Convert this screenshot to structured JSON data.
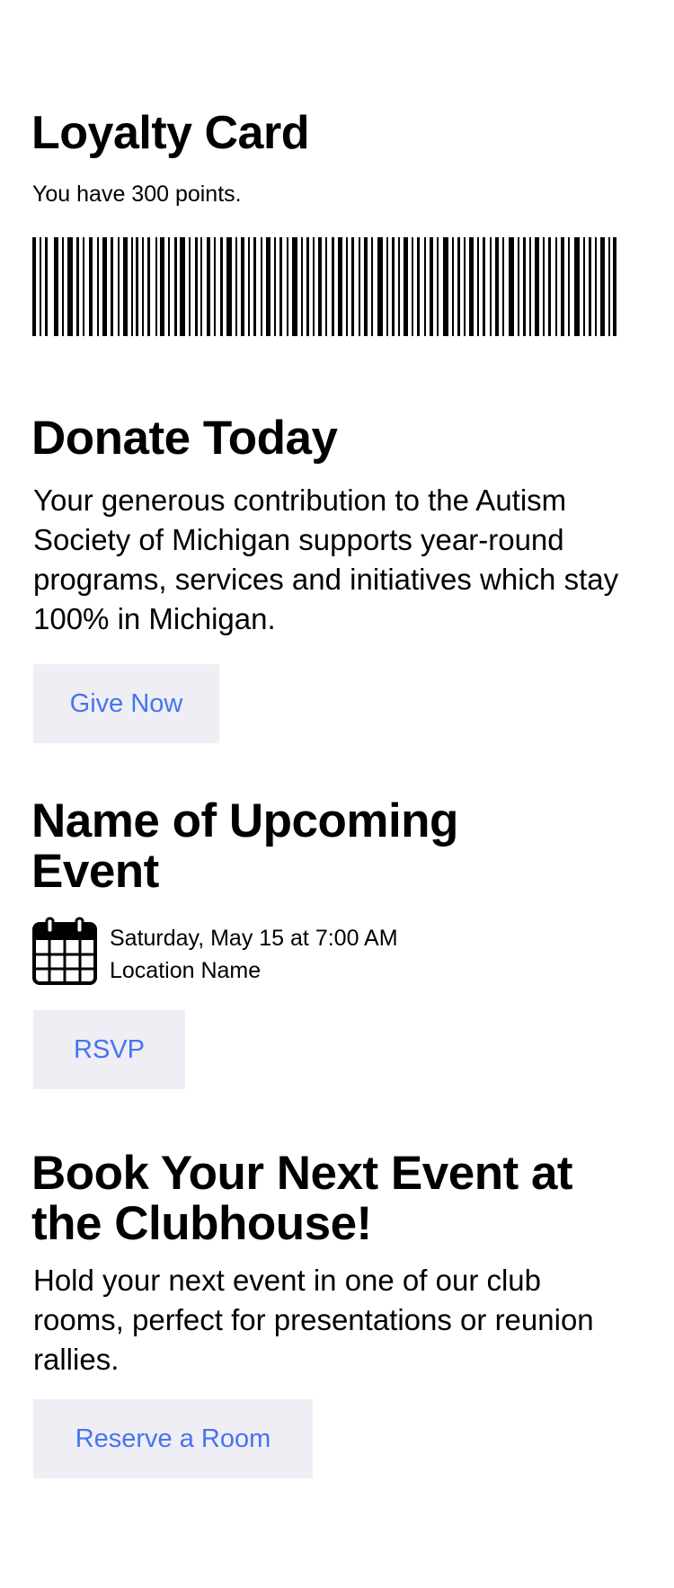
{
  "loyalty": {
    "title": "Loyalty Card",
    "points_text": "You have 300 points."
  },
  "donate": {
    "title": "Donate Today",
    "body": "Your generous contribution to the Autism Society of Michigan supports year-round programs, services and initiatives which stay 100% in Michigan.",
    "button_label": "Give Now"
  },
  "event": {
    "title": "Name of Upcoming Event",
    "date_time": "Saturday, May 15 at 7:00 AM",
    "location": "Location Name",
    "icon": "calendar-icon",
    "button_label": "RSVP"
  },
  "clubhouse": {
    "title": "Book Your Next Event at the Clubhouse!",
    "body": "Hold your next event in one of our club rooms, perfect for presentations or reunion rallies.",
    "button_label": "Reserve a Room"
  },
  "colors": {
    "accent": "#4674f0",
    "button_bg": "#eeeef4",
    "text": "#000000"
  }
}
